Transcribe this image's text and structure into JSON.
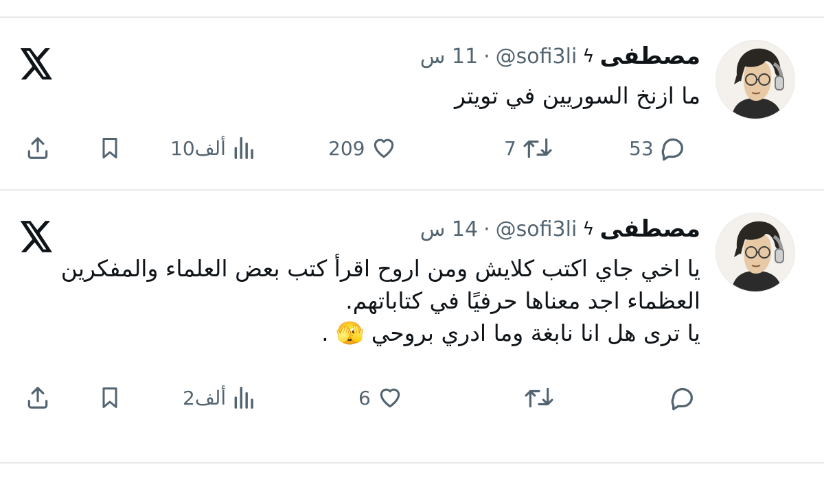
{
  "tweets": [
    {
      "author_name": "مصطفى",
      "badge": "ϟ",
      "handle": "@sofi3li",
      "separator": "·",
      "time": "11 س",
      "text_lines": [
        "ما ازنخ السوريين في تويتر"
      ],
      "replies": "53",
      "retweets": "7",
      "likes": "209",
      "views": "10ألف"
    },
    {
      "author_name": "مصطفى",
      "badge": "ϟ",
      "handle": "@sofi3li",
      "separator": "·",
      "time": "14 س",
      "text_lines": [
        "يا اخي جاي اكتب كلايش ومن اروح اقرأ كتب بعض العلماء والمفكرين العظماء اجد معناها حرفيًا في كتاباتهم.",
        "يا ترى هل انا نابغة وما ادري بروحي 🫣 ."
      ],
      "replies": "",
      "retweets": "",
      "likes": "6",
      "views": "2ألف"
    }
  ],
  "icons": {
    "reply": "reply-icon",
    "retweet": "retweet-icon",
    "like": "heart-icon",
    "views": "views-icon",
    "bookmark": "bookmark-icon",
    "share": "share-icon",
    "logo": "x-logo-icon"
  },
  "colors": {
    "text": "#0f1419",
    "secondary": "#536471",
    "divider": "#e7e9ea"
  }
}
